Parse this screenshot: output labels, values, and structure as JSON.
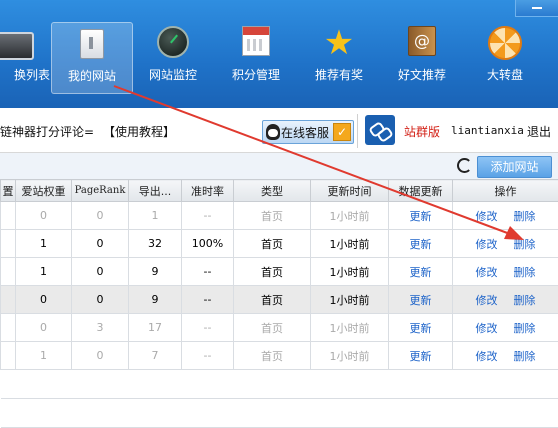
{
  "nav": [
    {
      "label": "换列表",
      "icon": "monitor-icon"
    },
    {
      "label": "我的网站",
      "icon": "site-page-icon",
      "active": true
    },
    {
      "label": "网站监控",
      "icon": "monitor-globe-icon"
    },
    {
      "label": "积分管理",
      "icon": "calendar-icon"
    },
    {
      "label": "推荐有奖",
      "icon": "star-icon"
    },
    {
      "label": "好文推荐",
      "icon": "at-book-icon"
    },
    {
      "label": "大转盘",
      "icon": "wheel-icon"
    }
  ],
  "notice": {
    "text": "链神器打分评论=",
    "tutorial": "【使用教程】",
    "service_button": "在线客服",
    "edition": "站群版",
    "username": "liantianxia",
    "logout": "退出"
  },
  "toolbar": {
    "add_site": "添加网站"
  },
  "columns": [
    "置",
    "爱站权重",
    "PageRank",
    "导出...",
    "准时率",
    "类型",
    "更新时间",
    "数据更新",
    "操作"
  ],
  "rows": [
    {
      "weight": "0",
      "pr": "0",
      "out": "1",
      "rate": "--",
      "type": "首页",
      "time": "1小时前",
      "dim": true
    },
    {
      "weight": "1",
      "pr": "0",
      "out": "32",
      "rate": "100%",
      "type": "首页",
      "time": "1小时前",
      "dim": false
    },
    {
      "weight": "1",
      "pr": "0",
      "out": "9",
      "rate": "--",
      "type": "首页",
      "time": "1小时前",
      "dim": false
    },
    {
      "weight": "0",
      "pr": "0",
      "out": "9",
      "rate": "--",
      "type": "首页",
      "time": "1小时前",
      "dim": false
    },
    {
      "weight": "0",
      "pr": "3",
      "out": "17",
      "rate": "--",
      "type": "首页",
      "time": "1小时前",
      "dim": true
    },
    {
      "weight": "1",
      "pr": "0",
      "out": "7",
      "rate": "--",
      "type": "首页",
      "time": "1小时前",
      "dim": true
    }
  ],
  "actions": {
    "update": "更新",
    "edit": "修改",
    "delete": "删除"
  },
  "colors": {
    "header_blue": "#1f72c8",
    "link_blue": "#1d63c9",
    "annotation_red": "#e03a2f"
  }
}
